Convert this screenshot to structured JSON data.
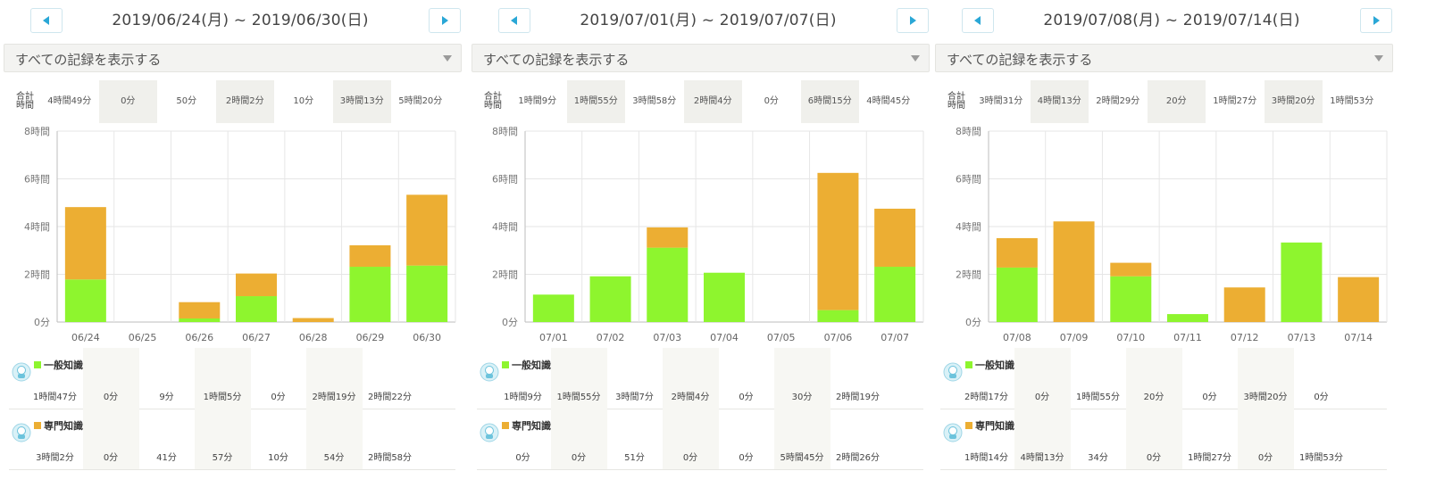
{
  "colors": {
    "general": "#8ef52e",
    "specialty": "#ecae33",
    "accent": "#2aa7d6",
    "grid": "#e6e6e6",
    "shade": "#f0f0ec"
  },
  "icons": {
    "prev": "chevron-left-icon",
    "next": "chevron-right-icon",
    "subject": "character-avatar-icon"
  },
  "labels": {
    "filter": "すべての記録を表示する",
    "totals": "合計時間",
    "totals_line1": "合計",
    "totals_line2": "時間",
    "general": "一般知識",
    "specialty": "専門知識"
  },
  "weeks": [
    {
      "range": "2019/06/24(月) ~ 2019/06/30(日)",
      "totals": [
        "4時間49分",
        "0分",
        "50分",
        "2時間2分",
        "10分",
        "3時間13分",
        "5時間20分"
      ],
      "general_times": [
        "1時間47分",
        "0分",
        "9分",
        "1時間5分",
        "0分",
        "2時間19分",
        "2時間22分"
      ],
      "specialty_times": [
        "3時間2分",
        "0分",
        "41分",
        "57分",
        "10分",
        "54分",
        "2時間58分"
      ]
    },
    {
      "range": "2019/07/01(月) ~ 2019/07/07(日)",
      "totals": [
        "1時間9分",
        "1時間55分",
        "3時間58分",
        "2時間4分",
        "0分",
        "6時間15分",
        "4時間45分"
      ],
      "general_times": [
        "1時間9分",
        "1時間55分",
        "3時間7分",
        "2時間4分",
        "0分",
        "30分",
        "2時間19分"
      ],
      "specialty_times": [
        "0分",
        "0分",
        "51分",
        "0分",
        "0分",
        "5時間45分",
        "2時間26分"
      ]
    },
    {
      "range": "2019/07/08(月) ~ 2019/07/14(日)",
      "totals": [
        "3時間31分",
        "4時間13分",
        "2時間29分",
        "20分",
        "1時間27分",
        "3時間20分",
        "1時間53分"
      ],
      "general_times": [
        "2時間17分",
        "0分",
        "1時間55分",
        "20分",
        "0分",
        "3時間20分",
        "0分"
      ],
      "specialty_times": [
        "1時間14分",
        "4時間13分",
        "34分",
        "0分",
        "1時間27分",
        "0分",
        "1時間53分"
      ]
    }
  ],
  "chart_data": [
    {
      "type": "bar",
      "stacked": true,
      "unit": "minutes",
      "categories": [
        "06/24",
        "06/25",
        "06/26",
        "06/27",
        "06/28",
        "06/29",
        "06/30"
      ],
      "series": [
        {
          "name": "一般知識",
          "values": [
            107,
            0,
            9,
            65,
            0,
            139,
            142
          ]
        },
        {
          "name": "専門知識",
          "values": [
            182,
            0,
            41,
            57,
            10,
            54,
            178
          ]
        }
      ],
      "ylim": [
        0,
        480
      ],
      "yticks": [
        0,
        120,
        240,
        360,
        480
      ],
      "ytick_labels": [
        "0分",
        "2時間",
        "4時間",
        "6時間",
        "8時間"
      ],
      "grid": true,
      "legend": "below"
    },
    {
      "type": "bar",
      "stacked": true,
      "unit": "minutes",
      "categories": [
        "07/01",
        "07/02",
        "07/03",
        "07/04",
        "07/05",
        "07/06",
        "07/07"
      ],
      "series": [
        {
          "name": "一般知識",
          "values": [
            69,
            115,
            187,
            124,
            0,
            30,
            139
          ]
        },
        {
          "name": "専門知識",
          "values": [
            0,
            0,
            51,
            0,
            0,
            345,
            146
          ]
        }
      ],
      "ylim": [
        0,
        480
      ],
      "yticks": [
        0,
        120,
        240,
        360,
        480
      ],
      "ytick_labels": [
        "0分",
        "2時間",
        "4時間",
        "6時間",
        "8時間"
      ],
      "grid": true,
      "legend": "below"
    },
    {
      "type": "bar",
      "stacked": true,
      "unit": "minutes",
      "categories": [
        "07/08",
        "07/09",
        "07/10",
        "07/11",
        "07/12",
        "07/13",
        "07/14"
      ],
      "series": [
        {
          "name": "一般知識",
          "values": [
            137,
            0,
            115,
            20,
            0,
            200,
            0
          ]
        },
        {
          "name": "専門知識",
          "values": [
            74,
            253,
            34,
            0,
            87,
            0,
            113
          ]
        }
      ],
      "ylim": [
        0,
        480
      ],
      "yticks": [
        0,
        120,
        240,
        360,
        480
      ],
      "ytick_labels": [
        "0分",
        "2時間",
        "4時間",
        "6時間",
        "8時間"
      ],
      "grid": true,
      "legend": "below"
    }
  ]
}
